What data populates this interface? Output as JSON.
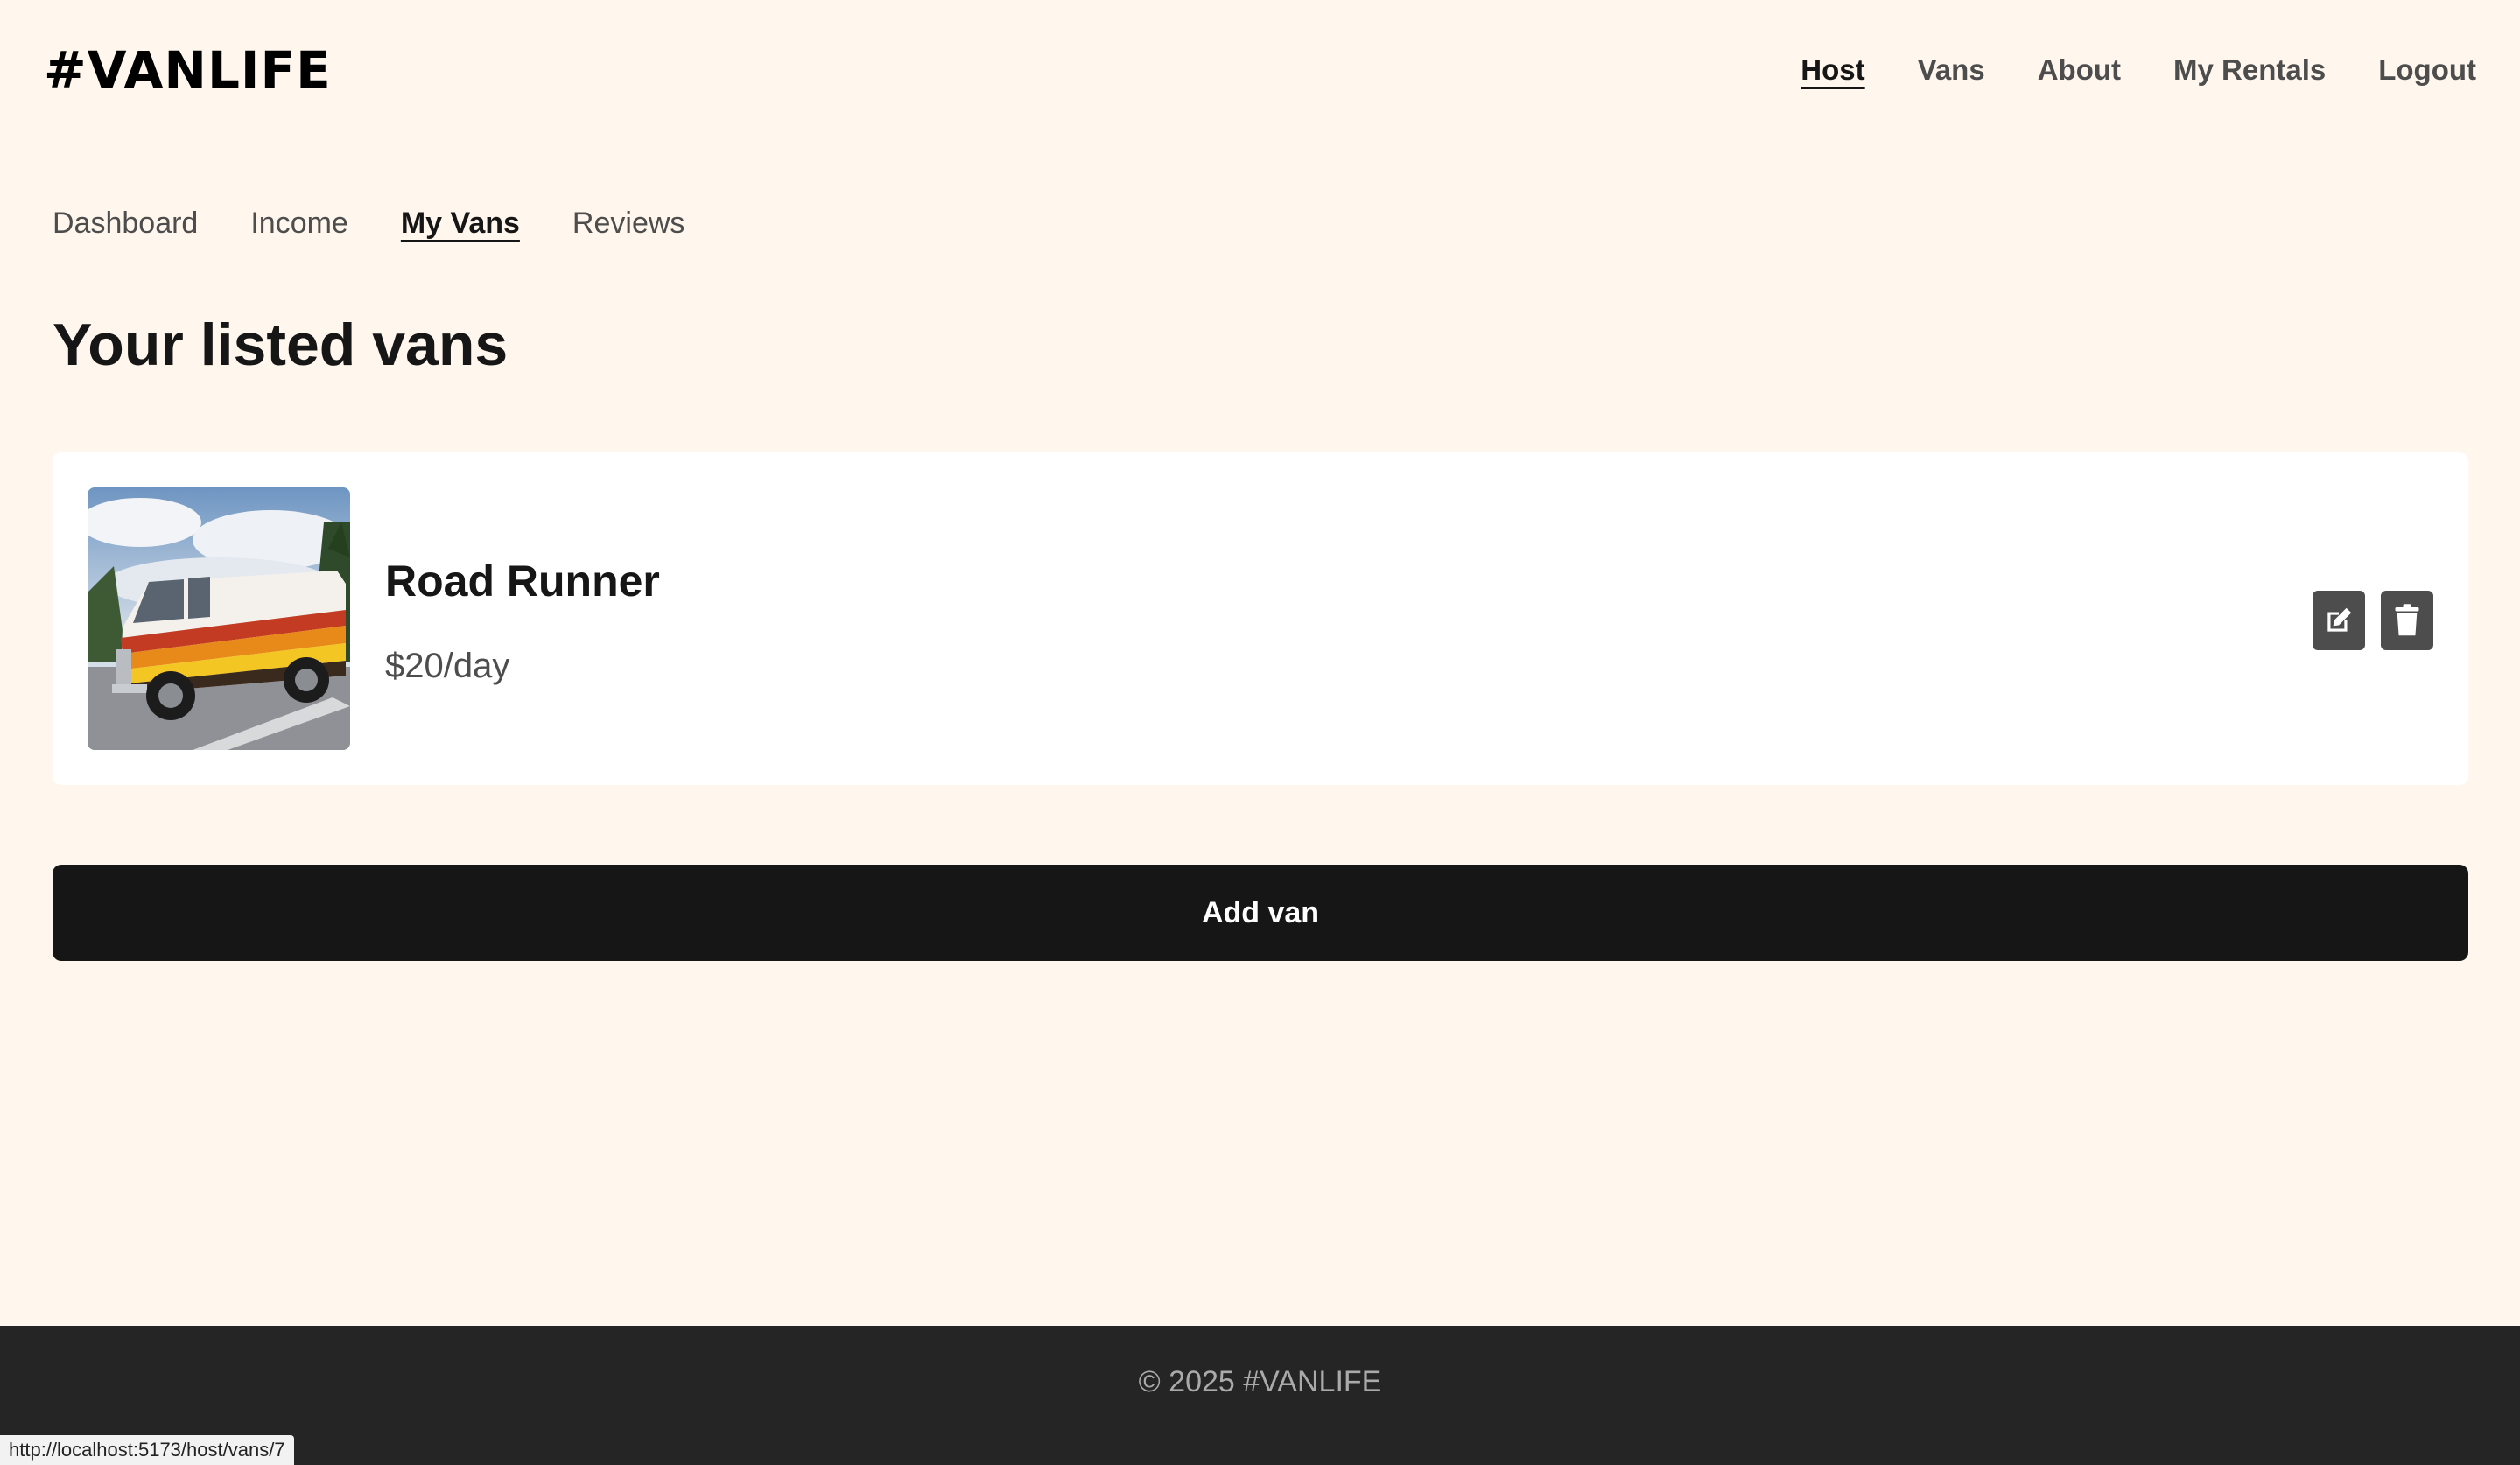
{
  "header": {
    "logo": "#VANLIFE",
    "nav": [
      {
        "label": "Host",
        "active": true
      },
      {
        "label": "Vans",
        "active": false
      },
      {
        "label": "About",
        "active": false
      },
      {
        "label": "My Rentals",
        "active": false
      },
      {
        "label": "Logout",
        "active": false
      }
    ]
  },
  "host_nav": [
    {
      "label": "Dashboard",
      "active": false
    },
    {
      "label": "Income",
      "active": false
    },
    {
      "label": "My Vans",
      "active": true
    },
    {
      "label": "Reviews",
      "active": false
    }
  ],
  "main": {
    "title": "Your listed vans",
    "vans": [
      {
        "name": "Road Runner",
        "price": "$20/day",
        "image": "retro-van-photo",
        "actions": [
          "edit-icon",
          "trash-icon"
        ]
      }
    ],
    "add_button": "Add van"
  },
  "footer": {
    "text": "© 2025 #VANLIFE"
  },
  "status_bar": {
    "url": "http://localhost:5173/host/vans/7"
  },
  "colors": {
    "background": "#FFF7ED",
    "text": "#161616",
    "muted": "#4D4D4D",
    "button": "#161616",
    "footer": "#252525"
  }
}
